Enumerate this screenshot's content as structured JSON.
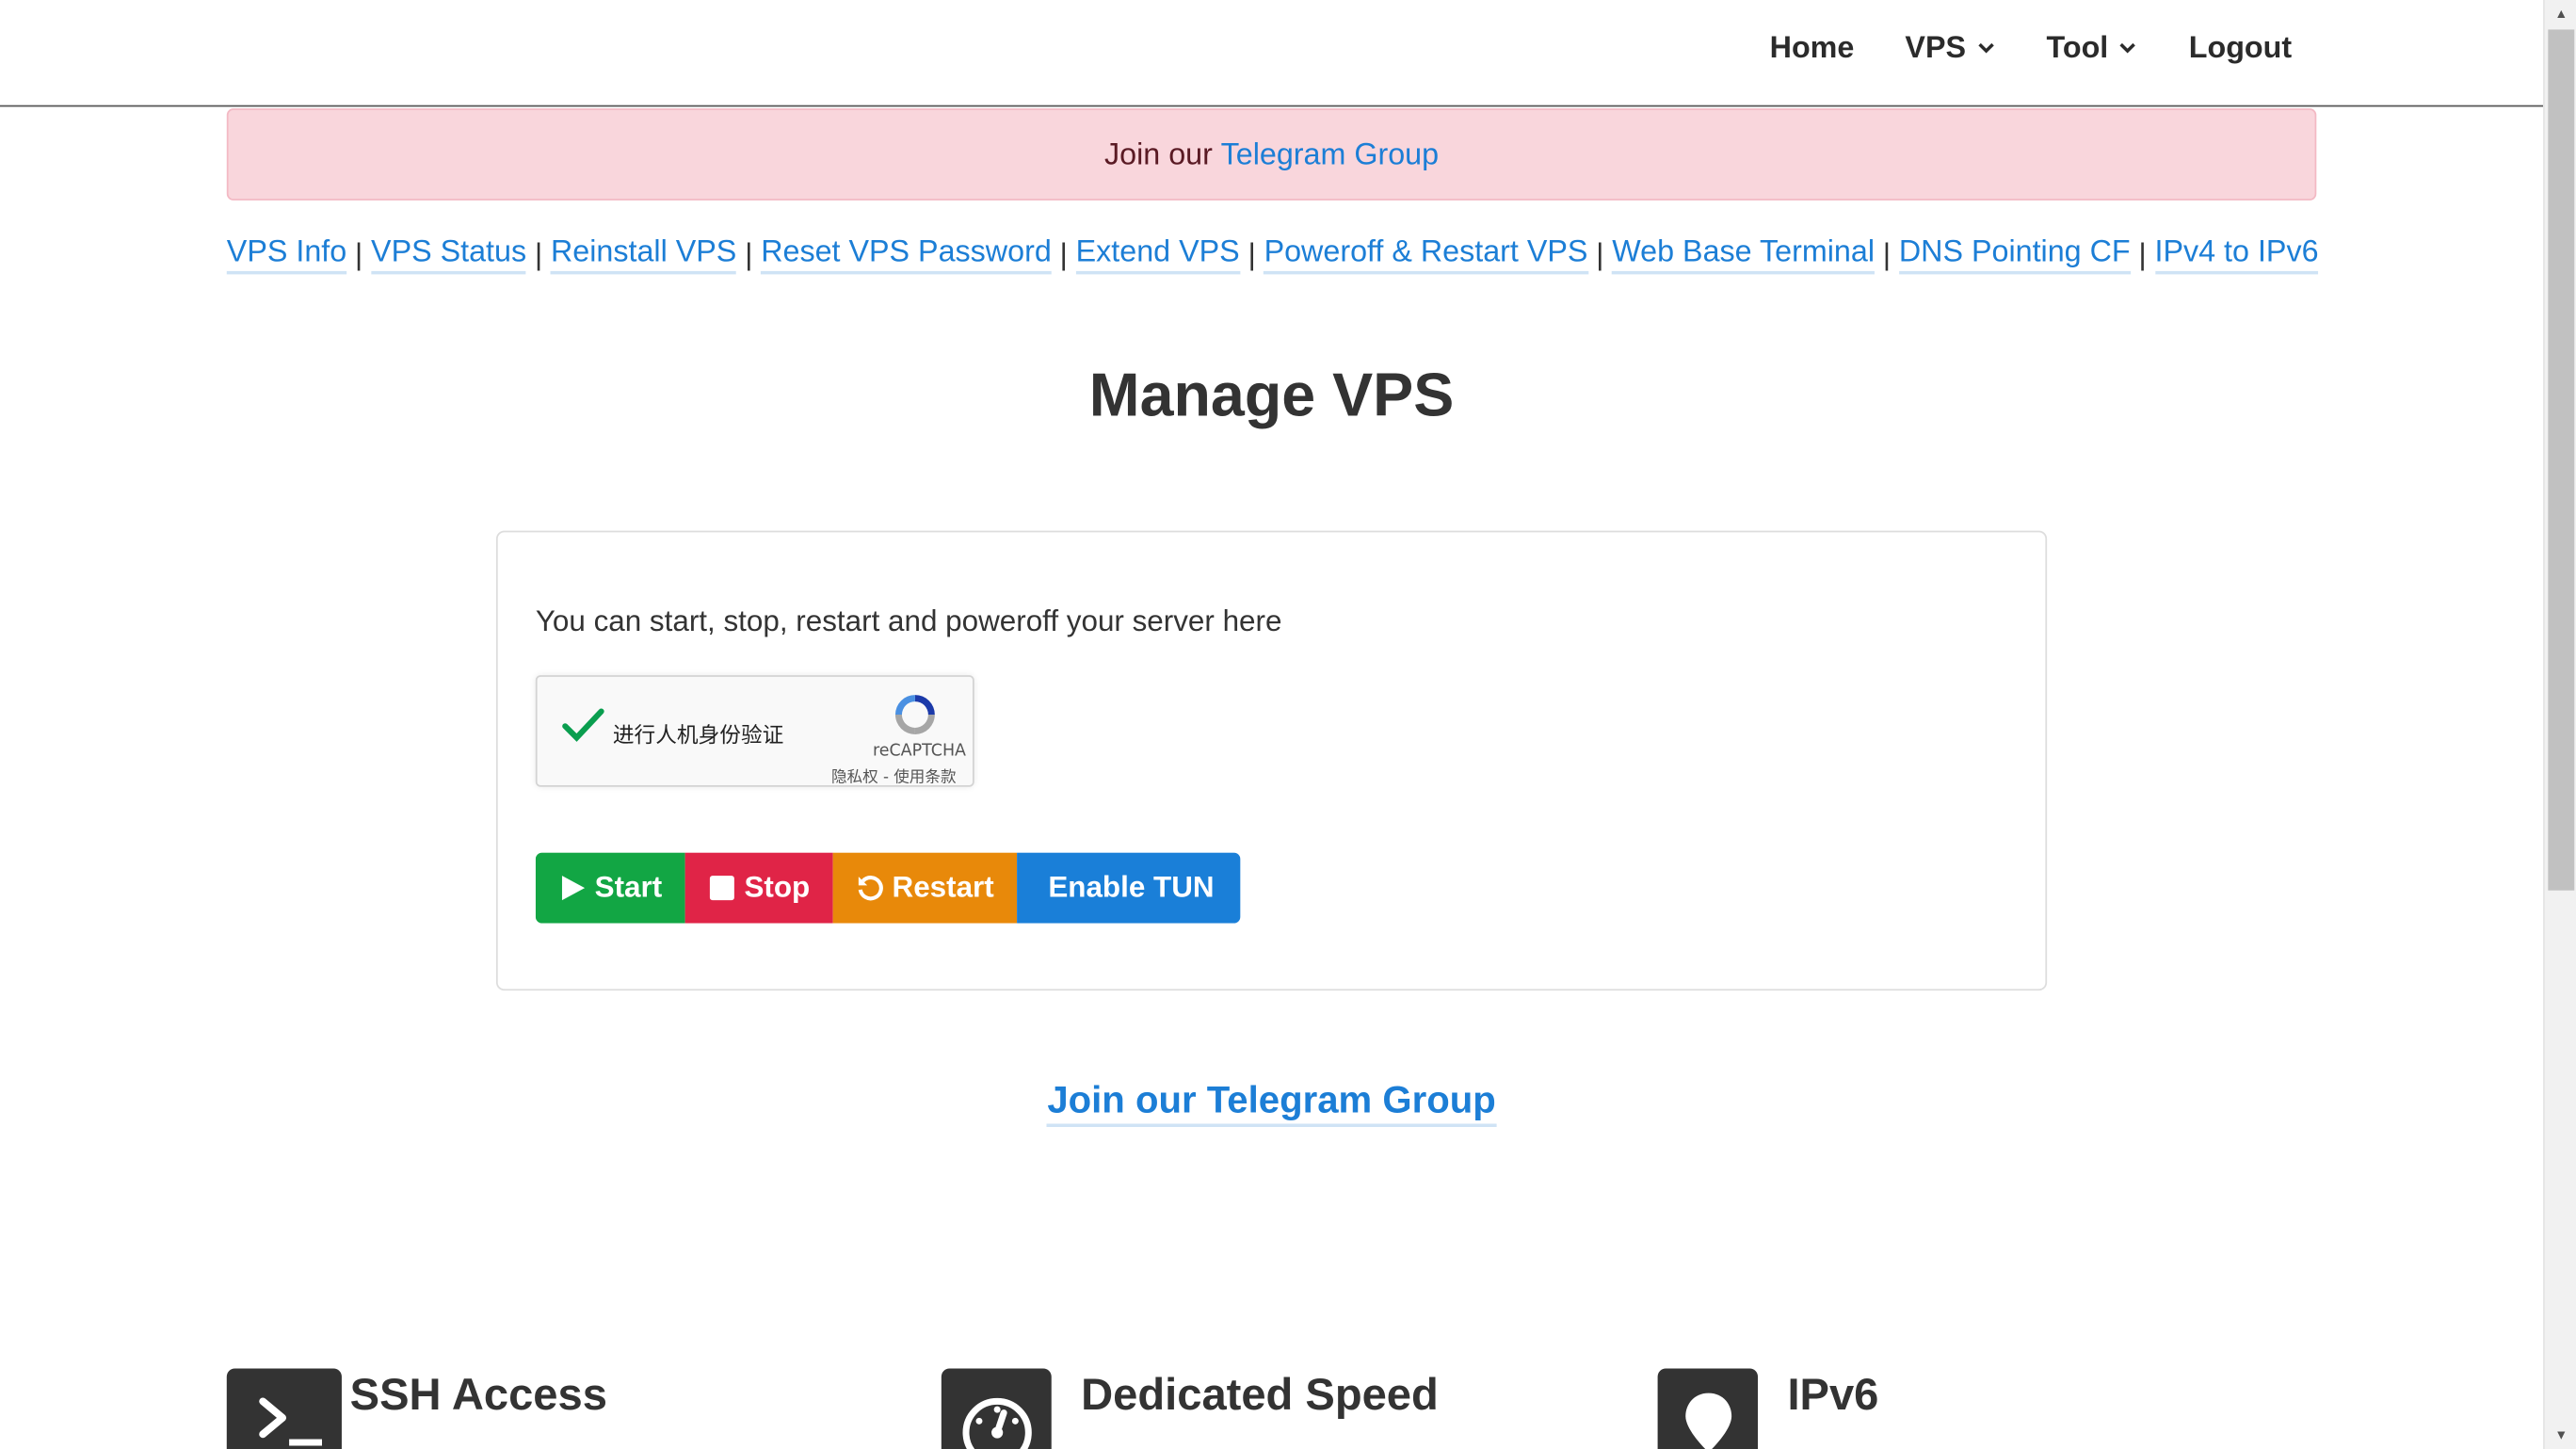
{
  "nav": {
    "home": "Home",
    "vps": "VPS",
    "tool": "Tool",
    "logout": "Logout"
  },
  "alert": {
    "prefix": "Join our",
    "link": "Telegram Group"
  },
  "links": [
    "VPS Info",
    "VPS Status",
    "Reinstall VPS",
    "Reset VPS Password",
    "Extend VPS",
    "Poweroff & Restart VPS",
    "Web Base Terminal",
    "DNS Pointing CF",
    "IPv4 to IPv6"
  ],
  "link_separator": "|",
  "page_title": "Manage VPS",
  "card": {
    "description": "You can start, stop, restart and poweroff your server here",
    "recaptcha": {
      "label": "进行人机身份验证",
      "brand": "reCAPTCHA",
      "terms": "隐私权 - 使用条款",
      "checked": true
    },
    "buttons": {
      "start": "Start",
      "stop": "Stop",
      "restart": "Restart",
      "tun": "Enable TUN"
    }
  },
  "telegram_link": "Join our Telegram Group",
  "features": [
    {
      "title": "SSH Access",
      "icon": "terminal-icon"
    },
    {
      "title": "Dedicated Speed",
      "icon": "speedometer-icon"
    },
    {
      "title": "IPv6",
      "icon": "map-pin-icon"
    }
  ],
  "colors": {
    "link": "#1c7ed6",
    "alert_bg": "#f9d6dc",
    "start": "#12a644",
    "stop": "#e02447",
    "restart": "#e8890a",
    "tun": "#1a7fd8"
  }
}
